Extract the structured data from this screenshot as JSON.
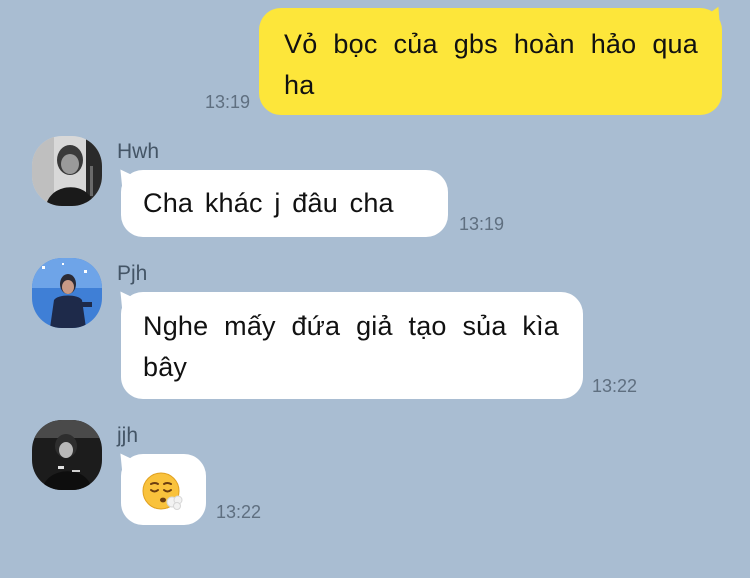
{
  "messages": [
    {
      "direction": "sent",
      "text": "Vỏ bọc của gbs hoàn hảo qua ha",
      "time": "13:19"
    },
    {
      "direction": "received",
      "sender": "Hwh",
      "avatar_icon": "user-photo-dark",
      "text": "Cha khác j đâu cha",
      "time": "13:19"
    },
    {
      "direction": "received",
      "sender": "Pjh",
      "avatar_icon": "user-photo-blue",
      "text": "Nghe mấy đứa giả tạo sủa kìa bây",
      "time": "13:22"
    },
    {
      "direction": "received",
      "sender": "jjh",
      "avatar_icon": "user-photo-stage",
      "text": "😮‍💨",
      "time": "13:22"
    }
  ],
  "colors": {
    "background": "#a9bdd2",
    "sent_bubble": "#fde63a",
    "received_bubble": "#ffffff"
  }
}
